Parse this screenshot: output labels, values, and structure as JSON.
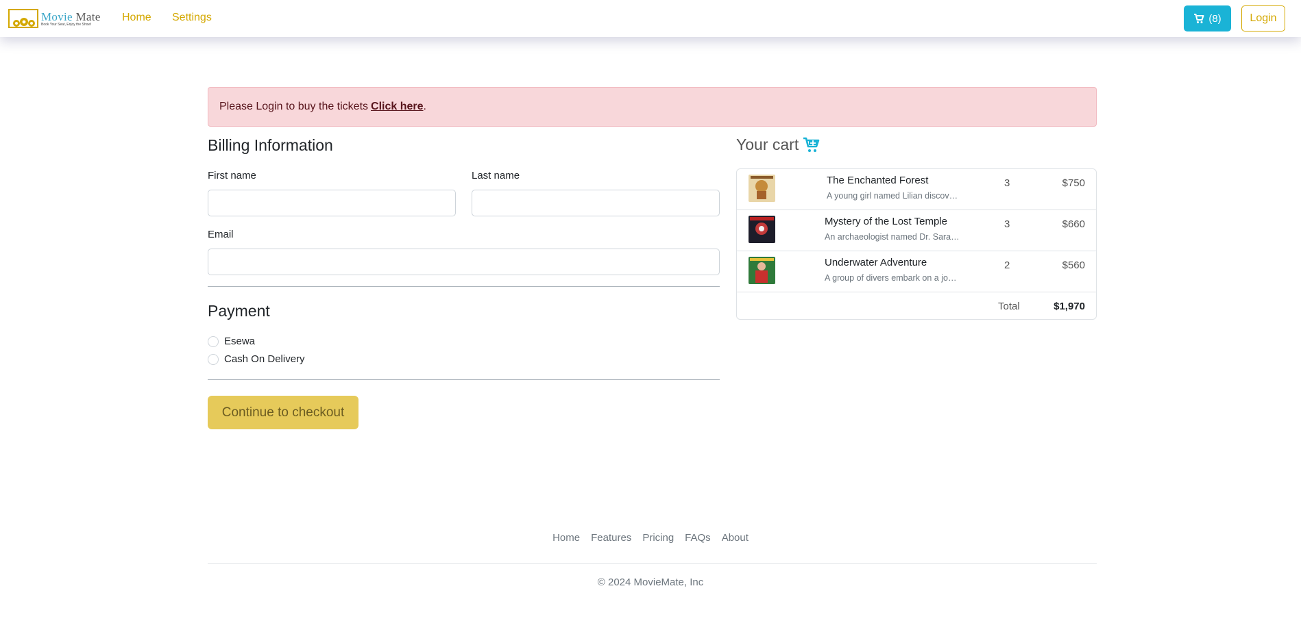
{
  "navbar": {
    "logo_name_first": "Movie",
    "logo_name_second": "Mate",
    "logo_tagline": "Book Your Seat, Enjoy the Show!",
    "links": [
      "Home",
      "Settings"
    ],
    "cart_count": "(8)",
    "cart_icon": "cart-icon",
    "login_label": "Login"
  },
  "alert": {
    "text": "Please Login to buy the tickets",
    "link_text": "Click here",
    "suffix": "."
  },
  "billing": {
    "title": "Billing Information",
    "first_name_label": "First name",
    "first_name_value": "",
    "last_name_label": "Last name",
    "last_name_value": "",
    "email_label": "Email",
    "email_value": ""
  },
  "payment": {
    "title": "Payment",
    "options": [
      "Esewa",
      "Cash On Delivery"
    ],
    "checkout_label": "Continue to checkout"
  },
  "cart": {
    "title": "Your cart",
    "icon": "cart-plus-icon",
    "items": [
      {
        "title": "The Enchanted Forest",
        "desc": "A young girl named Lilian discovers a magical forest",
        "qty": "3",
        "price": "$750"
      },
      {
        "title": "Mystery of the Lost Temple",
        "desc": "An archaeologist named Dr. Sarah uncovers",
        "qty": "3",
        "price": "$660"
      },
      {
        "title": "Underwater Adventure",
        "desc": "A group of divers embark on a journey",
        "qty": "2",
        "price": "$560"
      }
    ],
    "total_label": "Total",
    "total_value": "$1,970"
  },
  "footer": {
    "links": [
      "Home",
      "Features",
      "Pricing",
      "FAQs",
      "About"
    ],
    "copyright": "© 2024 MovieMate, Inc"
  },
  "colors": {
    "accent": "#d4a800",
    "info": "#1ab3d6",
    "alert_bg": "#f8d7da",
    "checkout_bg": "#e6ca5a"
  }
}
